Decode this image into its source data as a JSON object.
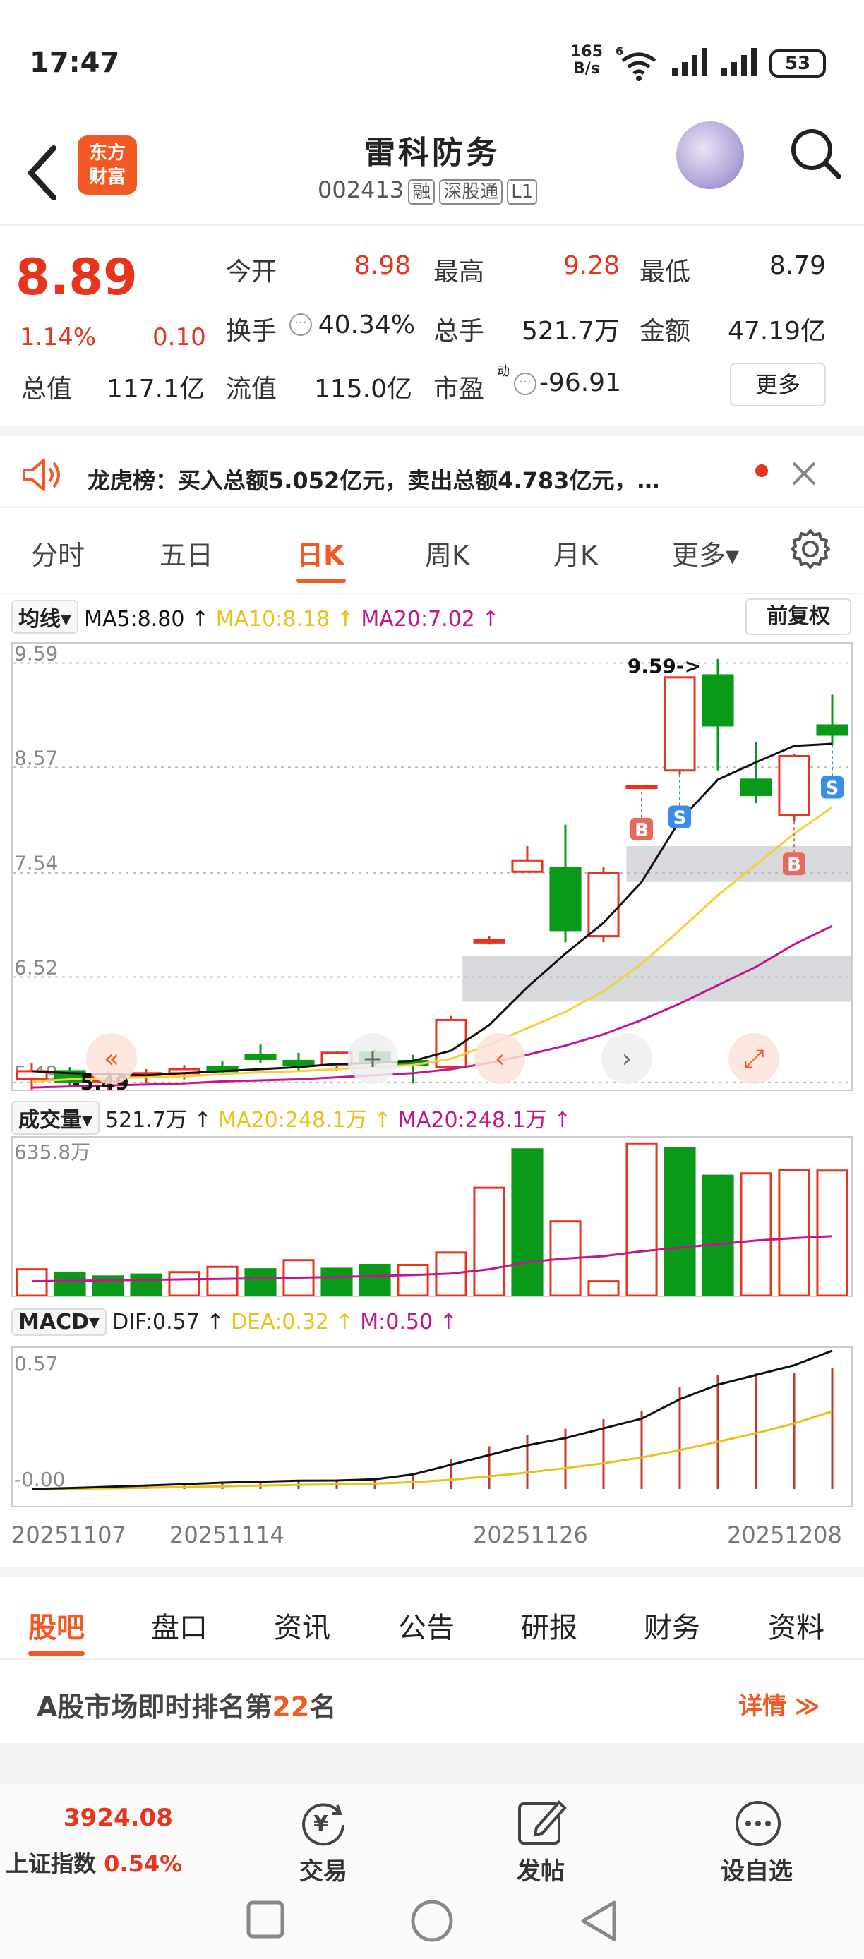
{
  "status_bar": {
    "time": "17:47",
    "net_speed_value": "165",
    "net_speed_unit": "B/s",
    "net_type": "6",
    "battery": "53"
  },
  "header": {
    "logo_line1": "东方",
    "logo_line2": "财富",
    "name": "雷科防务",
    "code": "002413",
    "tags": [
      "融",
      "深股通",
      "L1"
    ]
  },
  "quote": {
    "price": "8.89",
    "change_pct": "1.14%",
    "change": "0.10",
    "open_label": "今开",
    "open": "8.98",
    "high_label": "最高",
    "high": "9.28",
    "low_label": "最低",
    "low": "8.79",
    "turnover_label": "换手",
    "turnover": "40.34%",
    "volume_label": "总手",
    "volume": "521.7万",
    "amount_label": "金额",
    "amount": "47.19亿",
    "mktcap_label": "总值",
    "mktcap": "117.1亿",
    "float_label": "流值",
    "float": "115.0亿",
    "pe_label": "市盈",
    "pe_sup": "动",
    "pe": "-96.91",
    "more": "更多"
  },
  "notice": {
    "text": "龙虎榜：买入总额5.052亿元，卖出总额4.783亿元，…"
  },
  "ktabs": {
    "items": [
      "分时",
      "五日",
      "日K",
      "周K",
      "月K",
      "更多▾"
    ],
    "active": 2
  },
  "ma": {
    "selector": "均线▾",
    "ma5": "MA5:8.80 ↑",
    "ma10": "MA10:8.18 ↑",
    "ma20": "MA20:7.02 ↑",
    "adjust": "前复权"
  },
  "vol": {
    "selector": "成交量▾",
    "vol": "521.7万 ↑",
    "ma_a": "MA20:248.1万 ↑",
    "ma_b": "MA20:248.1万 ↑",
    "max_label": "635.8万"
  },
  "macd": {
    "selector": "MACD▾",
    "dif": "DIF:0.57 ↑",
    "dea": "DEA:0.32 ↑",
    "m": "M:0.50 ↑",
    "top_label": "0.57",
    "zero_label": "-0.00"
  },
  "dates": [
    "20251107",
    "20251114",
    "20251126",
    "20251208"
  ],
  "chart_data": [
    {
      "type": "candlestick",
      "title": "",
      "y_ticks": [
        "9.59",
        "8.57",
        "7.54",
        "6.52",
        "5.49"
      ],
      "ylim": [
        5.42,
        9.78
      ],
      "annotations": [
        "9.59->",
        "5.49"
      ],
      "markers": [
        {
          "index": 16,
          "label": "B"
        },
        {
          "index": 17,
          "label": "S"
        },
        {
          "index": 20,
          "label": "B"
        },
        {
          "index": 21,
          "label": "S"
        }
      ],
      "ohlc": [
        {
          "o": 5.52,
          "h": 5.68,
          "l": 5.4,
          "c": 5.6
        },
        {
          "o": 5.6,
          "h": 5.64,
          "l": 5.45,
          "c": 5.5
        },
        {
          "o": 5.5,
          "h": 5.6,
          "l": 5.42,
          "c": 5.57
        },
        {
          "o": 5.55,
          "h": 5.62,
          "l": 5.48,
          "c": 5.58
        },
        {
          "o": 5.58,
          "h": 5.66,
          "l": 5.52,
          "c": 5.62
        },
        {
          "o": 5.64,
          "h": 5.7,
          "l": 5.56,
          "c": 5.6
        },
        {
          "o": 5.76,
          "h": 5.86,
          "l": 5.68,
          "c": 5.72
        },
        {
          "o": 5.7,
          "h": 5.78,
          "l": 5.6,
          "c": 5.66
        },
        {
          "o": 5.66,
          "h": 5.8,
          "l": 5.6,
          "c": 5.78
        },
        {
          "o": 5.78,
          "h": 5.82,
          "l": 5.64,
          "c": 5.7
        },
        {
          "o": 5.7,
          "h": 5.76,
          "l": 5.48,
          "c": 5.66
        },
        {
          "o": 5.64,
          "h": 6.14,
          "l": 5.62,
          "c": 6.1
        },
        {
          "o": 6.86,
          "h": 6.92,
          "l": 6.84,
          "c": 6.88
        },
        {
          "o": 7.55,
          "h": 7.8,
          "l": 7.58,
          "c": 7.66
        },
        {
          "o": 7.59,
          "h": 8.01,
          "l": 6.86,
          "c": 6.98
        },
        {
          "o": 6.92,
          "h": 7.6,
          "l": 6.86,
          "c": 7.54
        },
        {
          "o": 8.38,
          "h": 8.4,
          "l": 8.38,
          "c": 8.39
        },
        {
          "o": 8.54,
          "h": 9.45,
          "l": 8.5,
          "c": 9.45
        },
        {
          "o": 9.47,
          "h": 9.63,
          "l": 8.54,
          "c": 8.98
        },
        {
          "o": 8.45,
          "h": 8.82,
          "l": 8.22,
          "c": 8.3
        },
        {
          "o": 8.1,
          "h": 8.7,
          "l": 8.04,
          "c": 8.68
        },
        {
          "o": 8.98,
          "h": 9.28,
          "l": 8.79,
          "c": 8.89
        }
      ],
      "ma5": [
        5.6,
        5.58,
        5.57,
        5.56,
        5.58,
        5.6,
        5.62,
        5.64,
        5.67,
        5.68,
        5.7,
        5.8,
        6.05,
        6.42,
        6.75,
        7.05,
        7.45,
        8.05,
        8.45,
        8.62,
        8.78,
        8.8
      ],
      "ma10": [
        5.5,
        5.52,
        5.53,
        5.54,
        5.55,
        5.57,
        5.59,
        5.6,
        5.62,
        5.64,
        5.66,
        5.72,
        5.86,
        6.02,
        6.18,
        6.38,
        6.65,
        6.98,
        7.32,
        7.62,
        7.92,
        8.18
      ],
      "ma20": [
        5.44,
        5.45,
        5.46,
        5.47,
        5.48,
        5.5,
        5.51,
        5.52,
        5.54,
        5.56,
        5.58,
        5.62,
        5.68,
        5.76,
        5.85,
        5.96,
        6.1,
        6.26,
        6.44,
        6.62,
        6.84,
        7.02
      ]
    },
    {
      "type": "bar",
      "title": "",
      "max": 635.8,
      "values": [
        110,
        96,
        80,
        88,
        98,
        120,
        110,
        148,
        112,
        128,
        128,
        180,
        450,
        610,
        310,
        60,
        635,
        615,
        500,
        510,
        525,
        521.7
      ],
      "up": [
        true,
        false,
        false,
        false,
        true,
        true,
        false,
        true,
        false,
        false,
        true,
        true,
        true,
        false,
        true,
        true,
        true,
        false,
        false,
        true,
        true,
        true
      ],
      "ma": [
        60,
        62,
        64,
        66,
        68,
        70,
        72,
        75,
        78,
        82,
        86,
        92,
        110,
        140,
        155,
        165,
        185,
        200,
        215,
        230,
        240,
        248.1
      ]
    },
    {
      "type": "line",
      "title": "",
      "ylim": [
        0,
        0.57
      ],
      "dif": [
        0.0,
        0.004,
        0.009,
        0.014,
        0.02,
        0.026,
        0.03,
        0.034,
        0.035,
        0.04,
        0.06,
        0.1,
        0.14,
        0.18,
        0.21,
        0.25,
        0.29,
        0.37,
        0.43,
        0.47,
        0.51,
        0.57
      ],
      "dea": [
        0.0,
        0.001,
        0.003,
        0.005,
        0.008,
        0.011,
        0.014,
        0.017,
        0.019,
        0.022,
        0.028,
        0.038,
        0.052,
        0.068,
        0.086,
        0.106,
        0.13,
        0.16,
        0.195,
        0.23,
        0.27,
        0.32
      ],
      "m": [
        0.0,
        0.006,
        0.012,
        0.018,
        0.024,
        0.03,
        0.032,
        0.034,
        0.032,
        0.036,
        0.064,
        0.124,
        0.176,
        0.224,
        0.248,
        0.288,
        0.32,
        0.42,
        0.47,
        0.48,
        0.48,
        0.5
      ]
    }
  ],
  "bottom_tabs": {
    "items": [
      "股吧",
      "盘口",
      "资讯",
      "公告",
      "研报",
      "财务",
      "资料"
    ],
    "active": 0
  },
  "rank": {
    "prefix": "A股市场即时排名第",
    "num": "22",
    "suffix": "名",
    "detail": "详情 ≫"
  },
  "bottom_bar": {
    "index_value": "3924.08",
    "index_name": "上证指数",
    "index_pct": "0.54%",
    "trade": "交易",
    "post": "发帖",
    "watch": "设自选"
  },
  "colors": {
    "up": "#e8341c",
    "down": "#0a9a1a",
    "accent": "#f15a22",
    "ma5": "#111111",
    "ma10": "#f0d23a",
    "ma20": "#c4168c"
  }
}
